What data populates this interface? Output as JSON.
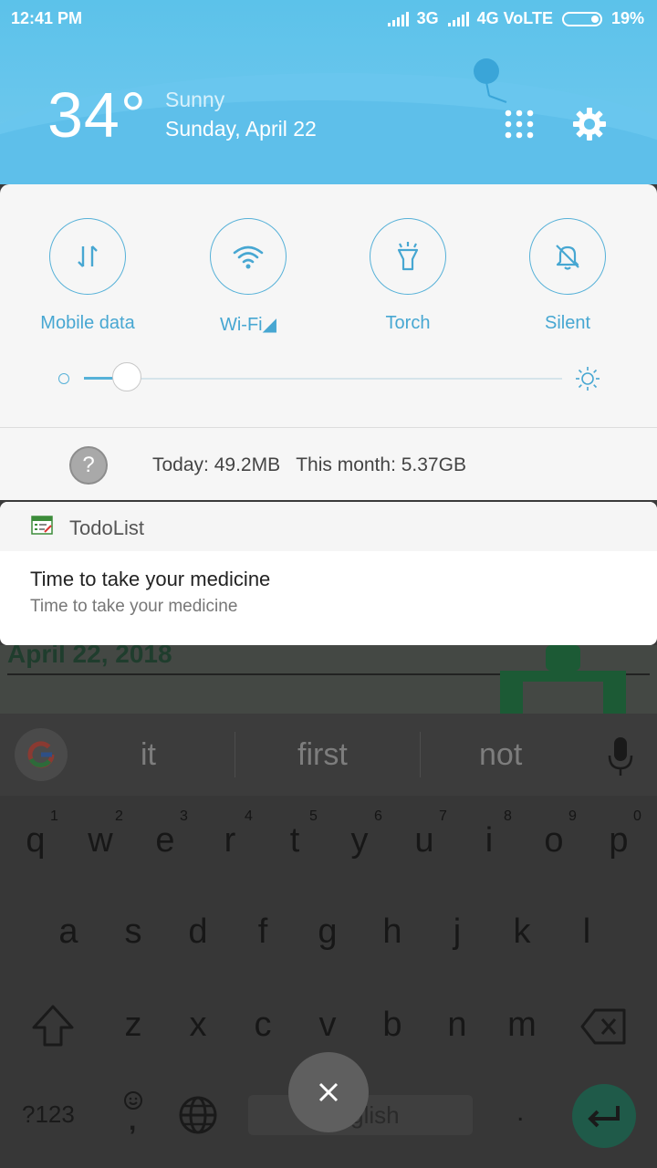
{
  "status_bar": {
    "time": "12:41 PM",
    "network1": "3G",
    "network2": "4G VoLTE",
    "battery": "19%"
  },
  "weather": {
    "temperature": "34°",
    "condition": "Sunny",
    "date": "Sunday, April 22"
  },
  "quick_settings": {
    "toggles": [
      {
        "label": "Mobile data",
        "icon": "mobile-data-icon"
      },
      {
        "label": "Wi-Fi◢",
        "icon": "wifi-icon"
      },
      {
        "label": "Torch",
        "icon": "torch-icon"
      },
      {
        "label": "Silent",
        "icon": "silent-bell-icon"
      }
    ],
    "brightness_level": 0.09,
    "data_usage": "Today: 49.2MB   This month: 5.37GB",
    "help_symbol": "?"
  },
  "notification": {
    "app_name": "TodoList",
    "title": "Time to take your medicine",
    "text": "Time to take your medicine"
  },
  "background_app": {
    "date_heading": "April 22, 2018"
  },
  "keyboard": {
    "suggestions": [
      "it",
      "first",
      "not"
    ],
    "row1": [
      "q",
      "w",
      "e",
      "r",
      "t",
      "y",
      "u",
      "i",
      "o",
      "p"
    ],
    "row1_numbers": [
      "1",
      "2",
      "3",
      "4",
      "5",
      "6",
      "7",
      "8",
      "9",
      "0"
    ],
    "row2": [
      "a",
      "s",
      "d",
      "f",
      "g",
      "h",
      "j",
      "k",
      "l"
    ],
    "row3": [
      "z",
      "x",
      "c",
      "v",
      "b",
      "n",
      "m"
    ],
    "symbols_key": "?123",
    "comma_key": ",",
    "period_key": ".",
    "space_label": "English"
  },
  "colors": {
    "accent": "#47a7d2",
    "header_sky": "#5cc2ea",
    "enter_key": "#1f5a49"
  }
}
